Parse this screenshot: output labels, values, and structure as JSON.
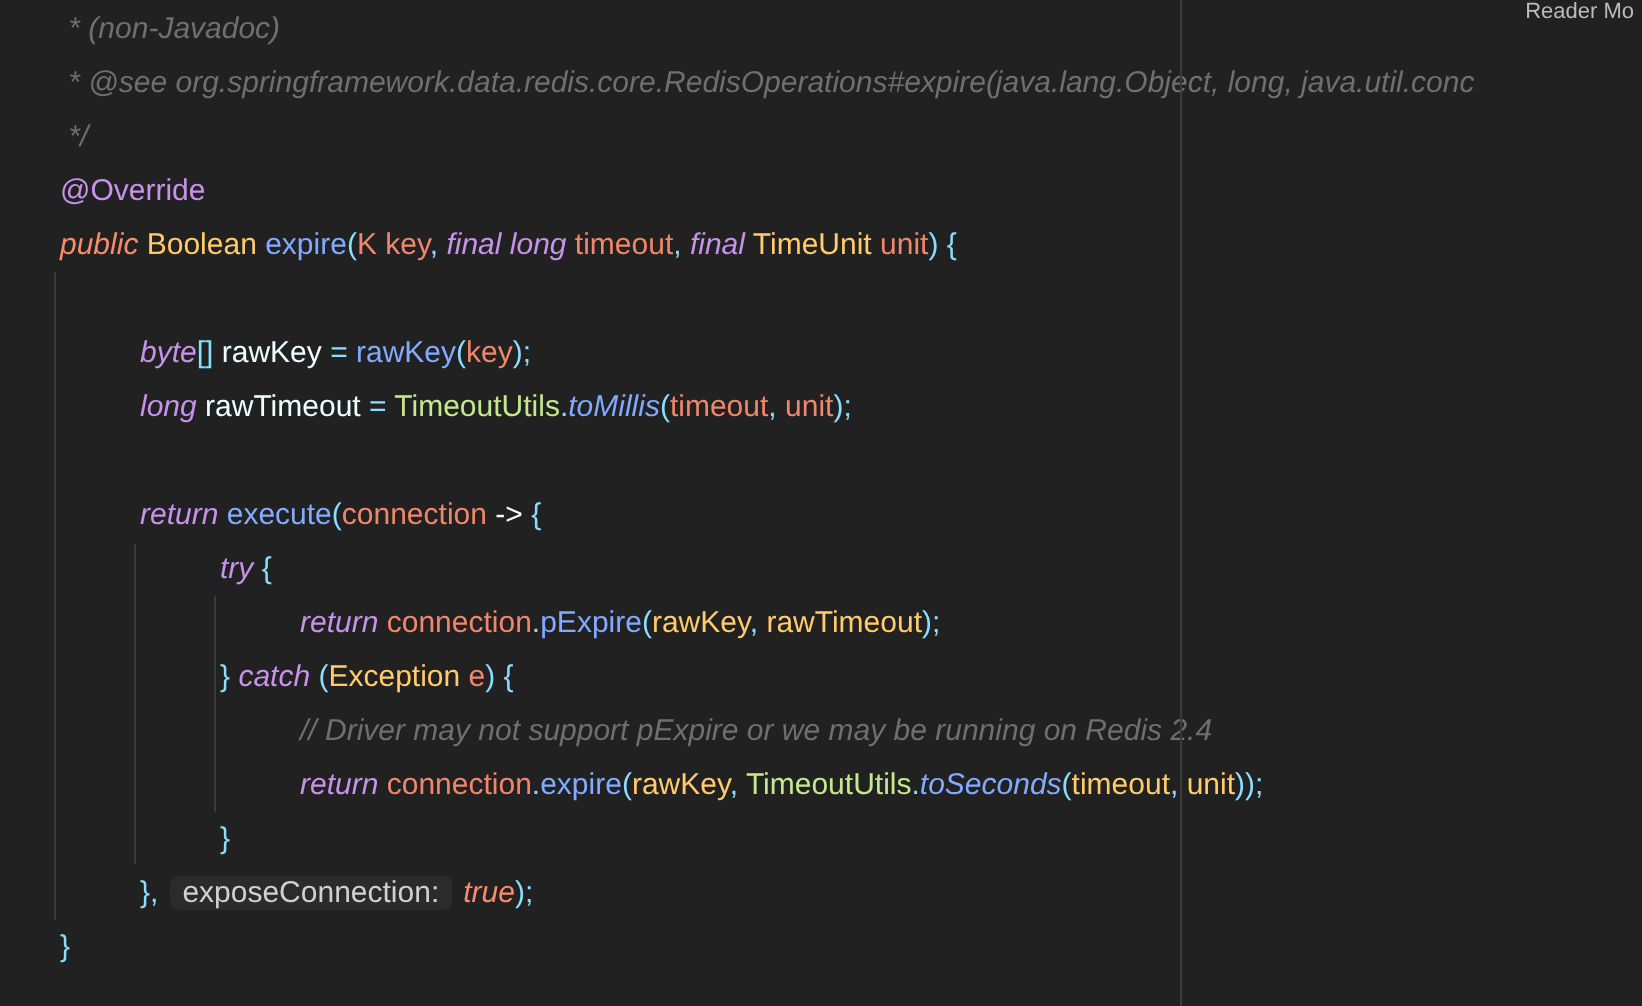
{
  "corner_label": "Reader Mo",
  "blocks": [
    {
      "lines": [
        {
          "tokens": [
            {
              "text": " * (non-Javadoc)",
              "kind": "comment"
            }
          ]
        },
        {
          "tokens": [
            {
              "text": " * @see org.springframework.data.redis.core.RedisOperations#expire(java.lang.Object, long, java.util.conc",
              "kind": "comment"
            }
          ]
        },
        {
          "tokens": [
            {
              "text": " */",
              "kind": "comment"
            }
          ]
        },
        {
          "tokens": [
            {
              "text": "@Override",
              "kind": "annotation"
            }
          ]
        },
        {
          "tokens": [
            {
              "text": "public",
              "kind": "modifier"
            },
            {
              "text": " Boolean",
              "kind": "type"
            },
            {
              "text": " expire",
              "kind": "method"
            },
            {
              "text": "(",
              "kind": "punct"
            },
            {
              "text": "K key",
              "kind": "param"
            },
            {
              "text": ", ",
              "kind": "punct"
            },
            {
              "text": "final long",
              "kind": "keyword"
            },
            {
              "text": " timeout",
              "kind": "param"
            },
            {
              "text": ", ",
              "kind": "punct"
            },
            {
              "text": "final",
              "kind": "keyword"
            },
            {
              "text": " TimeUnit",
              "kind": "type"
            },
            {
              "text": " unit",
              "kind": "param"
            },
            {
              "text": ") {",
              "kind": "punct"
            }
          ]
        }
      ]
    },
    {
      "lines": [
        {
          "tokens": [
            {
              "text": "\tbyte",
              "kind": "keyword"
            },
            {
              "text": "[]",
              "kind": "punct"
            },
            {
              "text": " rawKey ",
              "kind": "plain"
            },
            {
              "text": "= ",
              "kind": "punct"
            },
            {
              "text": "rawKey",
              "kind": "method"
            },
            {
              "text": "(",
              "kind": "punct"
            },
            {
              "text": "key",
              "kind": "param"
            },
            {
              "text": ");",
              "kind": "punct"
            }
          ]
        },
        {
          "tokens": [
            {
              "text": "\tlong",
              "kind": "keyword"
            },
            {
              "text": " rawTimeout ",
              "kind": "plain"
            },
            {
              "text": "= ",
              "kind": "punct"
            },
            {
              "text": "TimeoutUtils",
              "kind": "class"
            },
            {
              "text": ".",
              "kind": "punct"
            },
            {
              "text": "toMillis",
              "kind": "static"
            },
            {
              "text": "(",
              "kind": "punct"
            },
            {
              "text": "timeout",
              "kind": "param"
            },
            {
              "text": ", ",
              "kind": "punct"
            },
            {
              "text": "unit",
              "kind": "param"
            },
            {
              "text": ");",
              "kind": "punct"
            }
          ]
        }
      ]
    },
    {
      "lines": [
        {
          "tokens": [
            {
              "text": "\treturn",
              "kind": "keyword"
            },
            {
              "text": " execute",
              "kind": "method"
            },
            {
              "text": "(",
              "kind": "punct"
            },
            {
              "text": "connection",
              "kind": "param"
            },
            {
              "text": " -> ",
              "kind": "plain"
            },
            {
              "text": "{",
              "kind": "punct"
            }
          ]
        },
        {
          "tokens": [
            {
              "text": "\t\ttry",
              "kind": "keyword"
            },
            {
              "text": " {",
              "kind": "punct"
            }
          ]
        },
        {
          "tokens": [
            {
              "text": "\t\t\treturn",
              "kind": "keyword"
            },
            {
              "text": " connection",
              "kind": "param"
            },
            {
              "text": ".",
              "kind": "punct"
            },
            {
              "text": "pExpire",
              "kind": "method"
            },
            {
              "text": "(",
              "kind": "punct"
            },
            {
              "text": "rawKey",
              "kind": "field"
            },
            {
              "text": ", ",
              "kind": "punct"
            },
            {
              "text": "rawTimeout",
              "kind": "field"
            },
            {
              "text": ");",
              "kind": "punct"
            }
          ]
        },
        {
          "tokens": [
            {
              "text": "\t\t} ",
              "kind": "punct"
            },
            {
              "text": "catch",
              "kind": "keyword"
            },
            {
              "text": " (",
              "kind": "punct"
            },
            {
              "text": "Exception",
              "kind": "type"
            },
            {
              "text": " e",
              "kind": "param"
            },
            {
              "text": ") {",
              "kind": "punct"
            }
          ]
        },
        {
          "tokens": [
            {
              "text": "\t\t\t// Driver may not support pExpire or we may be running on Redis 2.4",
              "kind": "comment"
            }
          ]
        },
        {
          "tokens": [
            {
              "text": "\t\t\treturn",
              "kind": "keyword"
            },
            {
              "text": " connection",
              "kind": "param"
            },
            {
              "text": ".",
              "kind": "punct"
            },
            {
              "text": "expire",
              "kind": "method"
            },
            {
              "text": "(",
              "kind": "punct"
            },
            {
              "text": "rawKey",
              "kind": "field"
            },
            {
              "text": ", ",
              "kind": "punct"
            },
            {
              "text": "TimeoutUtils",
              "kind": "class"
            },
            {
              "text": ".",
              "kind": "punct"
            },
            {
              "text": "toSeconds",
              "kind": "static"
            },
            {
              "text": "(",
              "kind": "punct"
            },
            {
              "text": "timeout",
              "kind": "field"
            },
            {
              "text": ", ",
              "kind": "punct"
            },
            {
              "text": "unit",
              "kind": "field"
            },
            {
              "text": "));",
              "kind": "punct"
            }
          ]
        },
        {
          "tokens": [
            {
              "text": "\t\t}",
              "kind": "punct"
            }
          ]
        },
        {
          "tokens": [
            {
              "text": "\t},",
              "kind": "punct"
            },
            {
              "text": "exposeConnection:",
              "kind": "hint"
            },
            {
              "text": "true",
              "kind": "literal"
            },
            {
              "text": ");",
              "kind": "punct"
            }
          ]
        },
        {
          "tokens": [
            {
              "text": "}",
              "kind": "punct"
            }
          ]
        }
      ]
    }
  ]
}
